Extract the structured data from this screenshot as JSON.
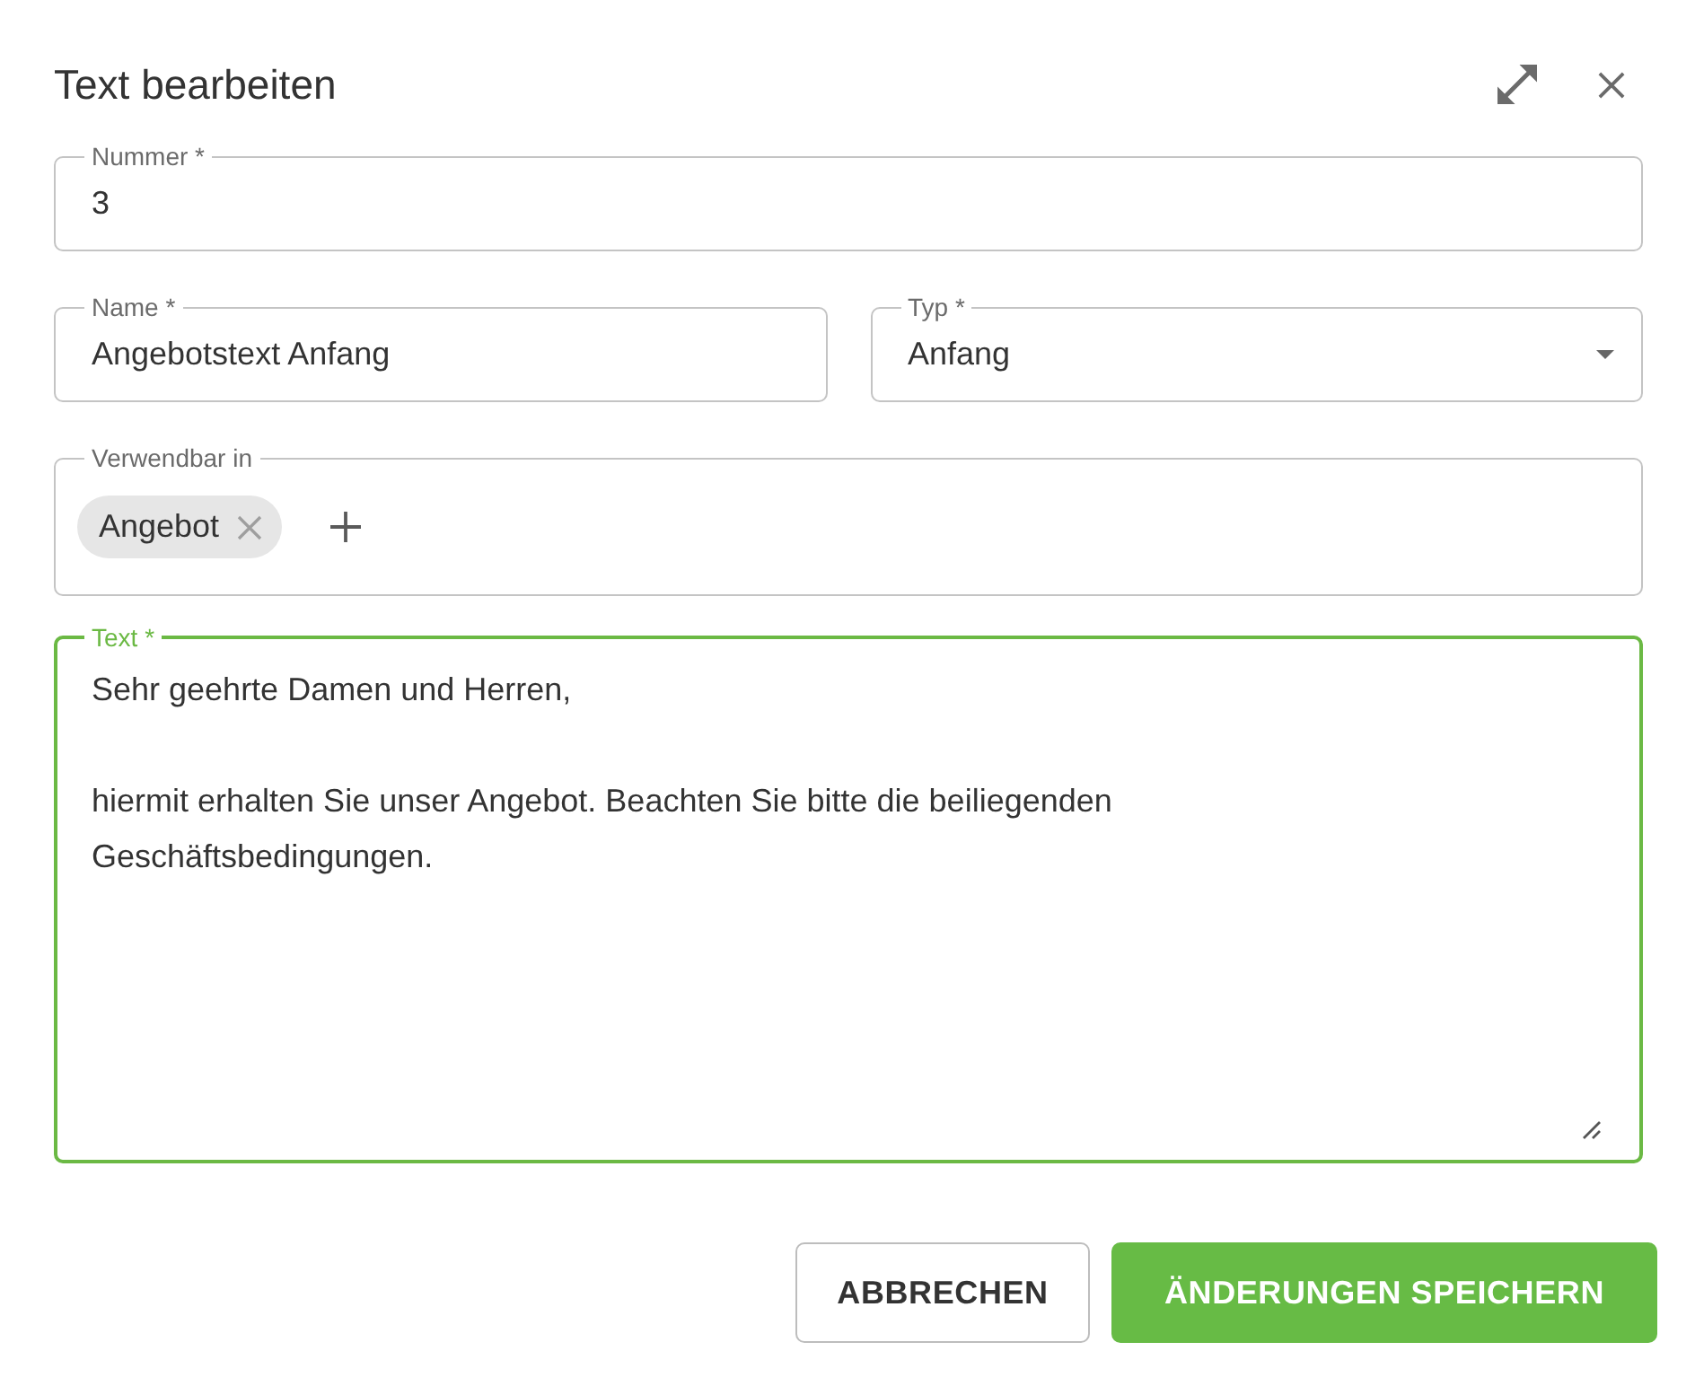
{
  "dialog": {
    "title": "Text bearbeiten"
  },
  "number_field": {
    "label": "Nummer *",
    "value": "3"
  },
  "name_field": {
    "label": "Name *",
    "value": "Angebotstext Anfang"
  },
  "type_field": {
    "label": "Typ *",
    "value": "Anfang"
  },
  "usable_in": {
    "label": "Verwendbar in",
    "chips": [
      {
        "label": "Angebot"
      }
    ]
  },
  "text_field": {
    "label": "Text *",
    "value": "Sehr geehrte Damen und Herren,\n\nhiermit erhalten Sie unser Angebot. Beachten Sie bitte die beiliegenden\nGeschäftsbedingungen.",
    "focused": true
  },
  "buttons": [
    {
      "label": "ABBRECHEN",
      "kind": "outlined"
    },
    {
      "label": "ÄNDERUNGEN SPEICHERN",
      "kind": "primary"
    }
  ]
}
